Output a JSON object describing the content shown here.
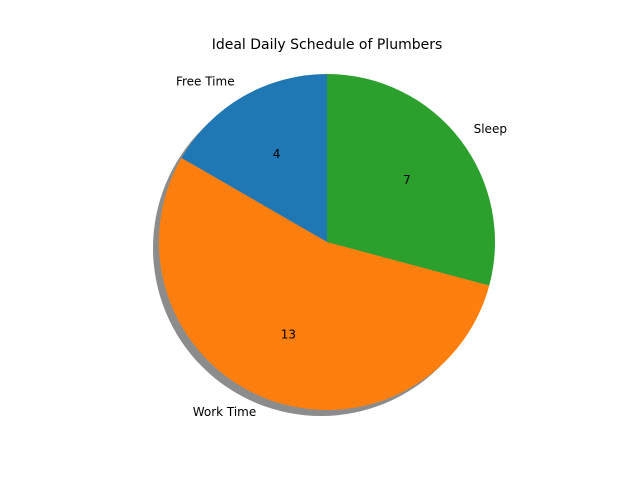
{
  "chart_data": {
    "type": "pie",
    "title": "Ideal Daily Schedule of Plumbers",
    "categories": [
      "Free Time",
      "Work Time",
      "Sleep"
    ],
    "values": [
      4,
      13,
      7
    ],
    "value_labels": [
      "4",
      "13",
      "7"
    ],
    "colors": [
      "#1f77b4",
      "#ff7f0e",
      "#2ca02c"
    ],
    "start_angle_deg": 90,
    "direction": "counterclockwise",
    "shadow": true,
    "legend": "none"
  }
}
